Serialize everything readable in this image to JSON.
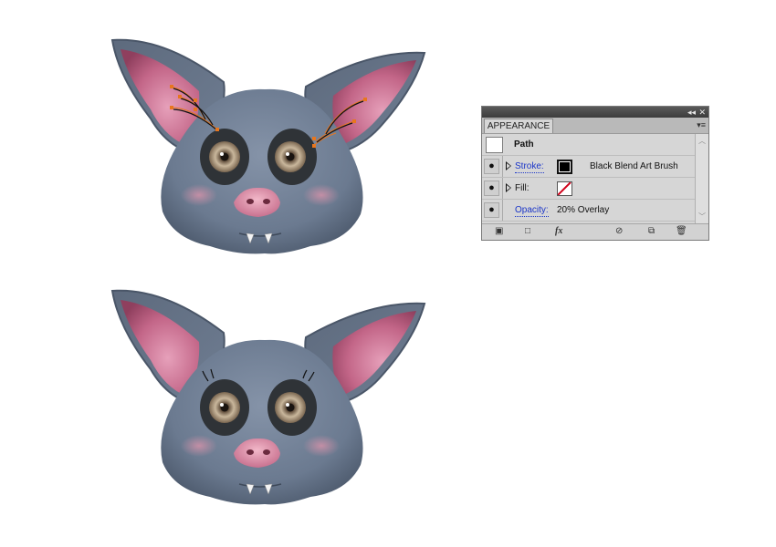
{
  "panel": {
    "tab_label": "APPEARANCE",
    "collapse_glyph": "◂◂",
    "close_glyph": "✕",
    "menu_glyph": "▾≡",
    "rows": {
      "path_label": "Path",
      "stroke_label": "Stroke:",
      "stroke_value": "Black Blend Art Brush",
      "fill_label": "Fill:",
      "opacity_label": "Opacity:",
      "opacity_value": "20% Overlay"
    },
    "footer": {
      "fx_label": "fx"
    }
  },
  "icons": [
    "eye-icon",
    "disclosure-triangle-icon",
    "add-new-stroke-icon",
    "add-new-fill-icon",
    "add-effect-icon",
    "clear-appearance-icon",
    "duplicate-item-icon",
    "delete-item-icon"
  ],
  "colors": {
    "bat_body": "#6f7f95",
    "ear_inner": "#b15a7a",
    "nose": "#e19ab0",
    "selection_path": "#e8761e",
    "panel_bg": "#d6d6d6"
  }
}
